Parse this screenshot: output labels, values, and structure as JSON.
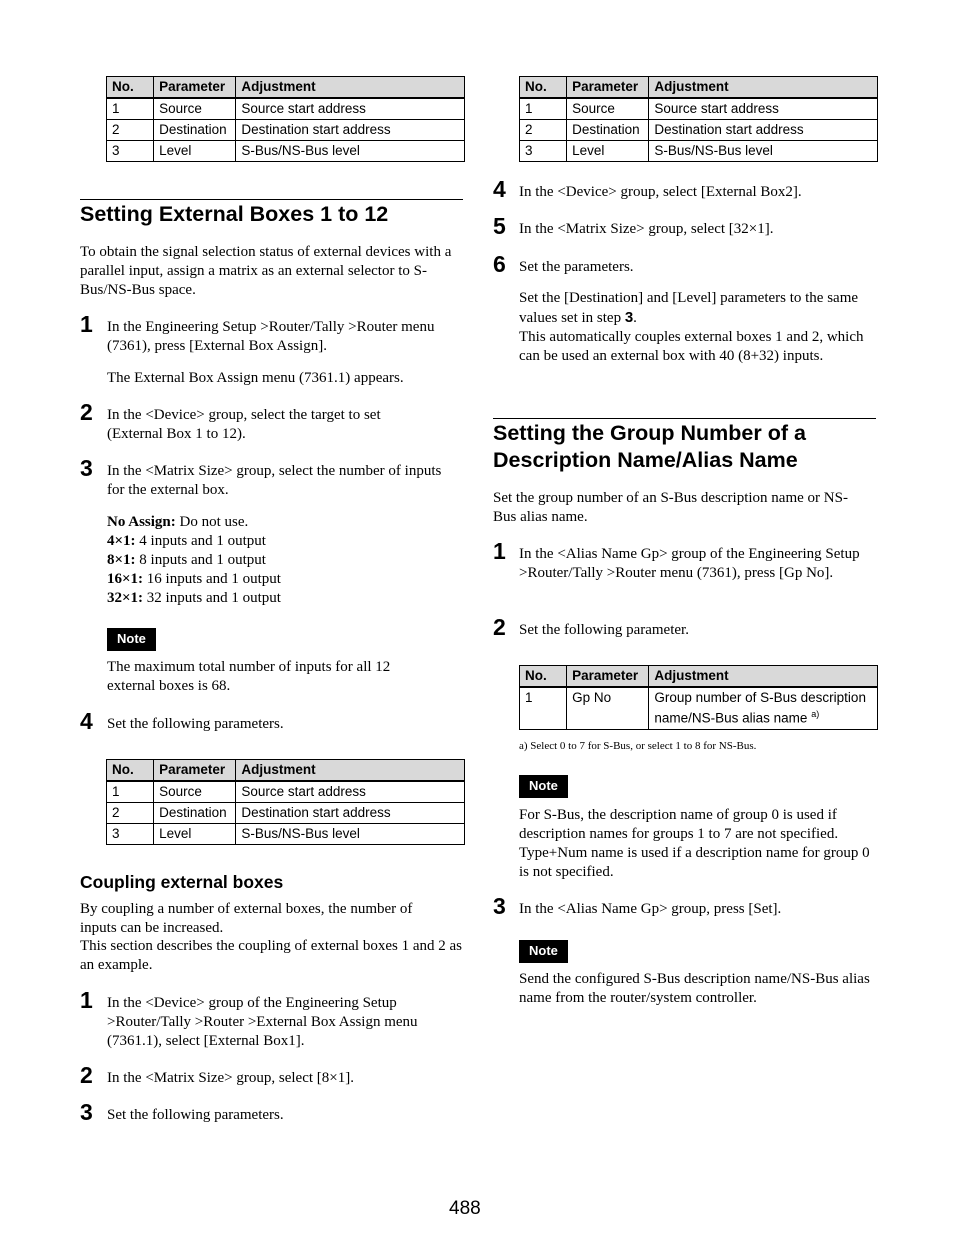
{
  "page_number": "488",
  "table_header": {
    "no": "No.",
    "parameter": "Parameter",
    "adjustment": "Adjustment"
  },
  "top_table_left": [
    {
      "no": "1",
      "parameter": "Source",
      "adjustment": "Source start address"
    },
    {
      "no": "2",
      "parameter": "Destination",
      "adjustment": "Destination start address"
    },
    {
      "no": "3",
      "parameter": "Level",
      "adjustment": "S-Bus/NS-Bus level"
    }
  ],
  "section1": {
    "title": "Setting External Boxes 1 to 12",
    "intro": "To obtain the signal selection status of external devices with a parallel input, assign a matrix as an external selector to S-Bus/NS-Bus space.",
    "steps": [
      {
        "num": "1",
        "text": "In the Engineering Setup >Router/Tally >Router menu (7361), press [External Box Assign].",
        "sub": "The External Box Assign menu (7361.1) appears."
      },
      {
        "num": "2",
        "text": "In the <Device> group, select the target to set (External Box 1 to 12)."
      },
      {
        "num": "3",
        "text": "In the <Matrix Size> group, select the number of inputs for the external box."
      },
      {
        "num": "4",
        "text": "Set the following parameters."
      }
    ],
    "matrix_options": [
      {
        "label": "No Assign:",
        "desc": " Do not use."
      },
      {
        "label": "4×1:",
        "desc": " 4 inputs and 1 output"
      },
      {
        "label": "8×1:",
        "desc": " 8 inputs and 1 output"
      },
      {
        "label": "16×1:",
        "desc": " 16 inputs and 1 output"
      },
      {
        "label": "32×1:",
        "desc": " 32 inputs and 1 output"
      }
    ],
    "note_label": "Note",
    "note_text": "The maximum total number of inputs for all 12 external boxes is 68.",
    "table": [
      {
        "no": "1",
        "parameter": "Source",
        "adjustment": "Source start address"
      },
      {
        "no": "2",
        "parameter": "Destination",
        "adjustment": "Destination start address"
      },
      {
        "no": "3",
        "parameter": "Level",
        "adjustment": "S-Bus/NS-Bus level"
      }
    ]
  },
  "coupling": {
    "title": "Coupling external boxes",
    "intro1": "By coupling a number of external boxes, the number of inputs can be increased.",
    "intro2": "This section describes the coupling of external boxes 1 and 2 as an example.",
    "steps": [
      {
        "num": "1",
        "text": "In the <Device> group of the Engineering Setup >Router/Tally >Router >External Box Assign menu (7361.1), select [External Box1]."
      },
      {
        "num": "2",
        "text": "In the <Matrix Size> group, select [8×1]."
      },
      {
        "num": "3",
        "text": "Set the following parameters."
      },
      {
        "num": "4",
        "text": "In the <Device> group, select [External Box2]."
      },
      {
        "num": "5",
        "text": "In the <Matrix Size> group, select [32×1]."
      },
      {
        "num": "6",
        "text": "Set the parameters."
      }
    ],
    "table": [
      {
        "no": "1",
        "parameter": "Source",
        "adjustment": "Source start address"
      },
      {
        "no": "2",
        "parameter": "Destination",
        "adjustment": "Destination start address"
      },
      {
        "no": "3",
        "parameter": "Level",
        "adjustment": "S-Bus/NS-Bus level"
      }
    ],
    "step6_a": "Set the [Destination] and [Level] parameters to the same values set in step ",
    "step6_ref": "3",
    "step6_b": ".",
    "step6_c": "This automatically couples external boxes 1 and 2, which can be used an external box with 40 (8+32) inputs."
  },
  "section2": {
    "title_line1": "Setting the Group Number of a",
    "title_line2": "Description Name/Alias Name",
    "intro": "Set the group number of an S-Bus description name or NS-Bus alias name.",
    "steps": [
      {
        "num": "1",
        "text": "In the <Alias Name Gp> group of the Engineering Setup >Router/Tally >Router menu (7361), press [Gp No]."
      },
      {
        "num": "2",
        "text": "Set the following parameter."
      },
      {
        "num": "3",
        "text": "In the <Alias Name Gp> group, press [Set]."
      }
    ],
    "table": [
      {
        "no": "1",
        "parameter": "Gp No",
        "adjustment": "Group number of S-Bus description name/NS-Bus alias name",
        "footnote_mark": "a)"
      }
    ],
    "footnote": "a) Select 0 to 7 for S-Bus, or select 1 to 8 for NS-Bus.",
    "note_label": "Note",
    "note1": "For S-Bus, the description name of group 0 is used if description names for groups 1 to 7 are not specified. Type+Num name is used if a description name for group 0 is not specified.",
    "note2": "Send the configured S-Bus description name/NS-Bus alias name from the router/system controller."
  }
}
